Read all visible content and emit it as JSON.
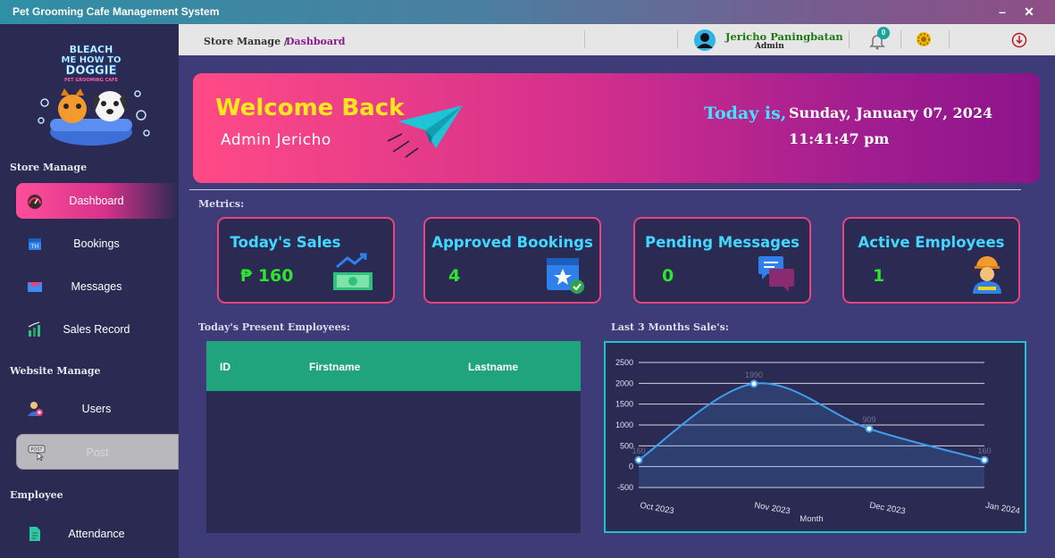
{
  "window": {
    "title": "Pet Grooming Cafe Management System",
    "minimize": "–",
    "close": "✕"
  },
  "sidebar": {
    "logo_text": [
      "BLEACH",
      "ME HOW TO",
      "DOGGIE",
      "PET GROOMING CAFE"
    ],
    "sections": {
      "store": "Store Manage",
      "website": "Website Manage",
      "employee": "Employee"
    },
    "items": [
      {
        "label": "Dashboard",
        "icon": "speedometer-icon"
      },
      {
        "label": "Bookings",
        "icon": "calendar-icon"
      },
      {
        "label": "Messages",
        "icon": "mail-icon"
      },
      {
        "label": "Sales Record",
        "icon": "sales-chart-icon"
      },
      {
        "label": "Users",
        "icon": "user-add-icon"
      },
      {
        "label": "Post",
        "icon": "post-cursor-icon"
      },
      {
        "label": "Attendance",
        "icon": "document-icon"
      }
    ]
  },
  "topbar": {
    "breadcrumb_root": "Store Manage /",
    "breadcrumb_current": "Dashboard",
    "user_name": "Jericho Paningbatan",
    "user_role": "Admin",
    "notification_count": "0"
  },
  "banner": {
    "welcome": "Welcome Back",
    "admin_name": "Admin Jericho",
    "today_label": "Today is,",
    "date": "Sunday, January 07, 2024",
    "time": "11:41:47 pm"
  },
  "metrics_label": "Metrics:",
  "metrics": [
    {
      "title": "Today's Sales",
      "value": "₱ 160",
      "icon": "cash-icon"
    },
    {
      "title": "Approved Bookings",
      "value": "4",
      "icon": "calendar-check-icon"
    },
    {
      "title": "Pending Messages",
      "value": "0",
      "icon": "chat-bubbles-icon"
    },
    {
      "title": "Active Employees",
      "value": "1",
      "icon": "worker-icon"
    }
  ],
  "employees": {
    "label": "Today's Present Employees:",
    "columns": [
      "ID",
      "Firstname",
      "Lastname"
    ],
    "rows": []
  },
  "sales_chart_label": "Last 3 Months Sale's:",
  "chart_data": {
    "type": "area",
    "categories": [
      "Oct 2023",
      "Nov 2023",
      "Dec 2023",
      "Jan 2024"
    ],
    "series": [
      {
        "values": [
          160,
          1990,
          909,
          160
        ]
      }
    ],
    "data_labels": [
      "160",
      "1990",
      "909",
      "160"
    ],
    "xlabel": "Month",
    "ylabel": "",
    "ylim": [
      -500,
      2500
    ],
    "yticks": [
      "2500",
      "2000",
      "1500",
      "1000",
      "500",
      "0",
      "-500"
    ],
    "grid": true,
    "line_color": "#3f9df0"
  }
}
